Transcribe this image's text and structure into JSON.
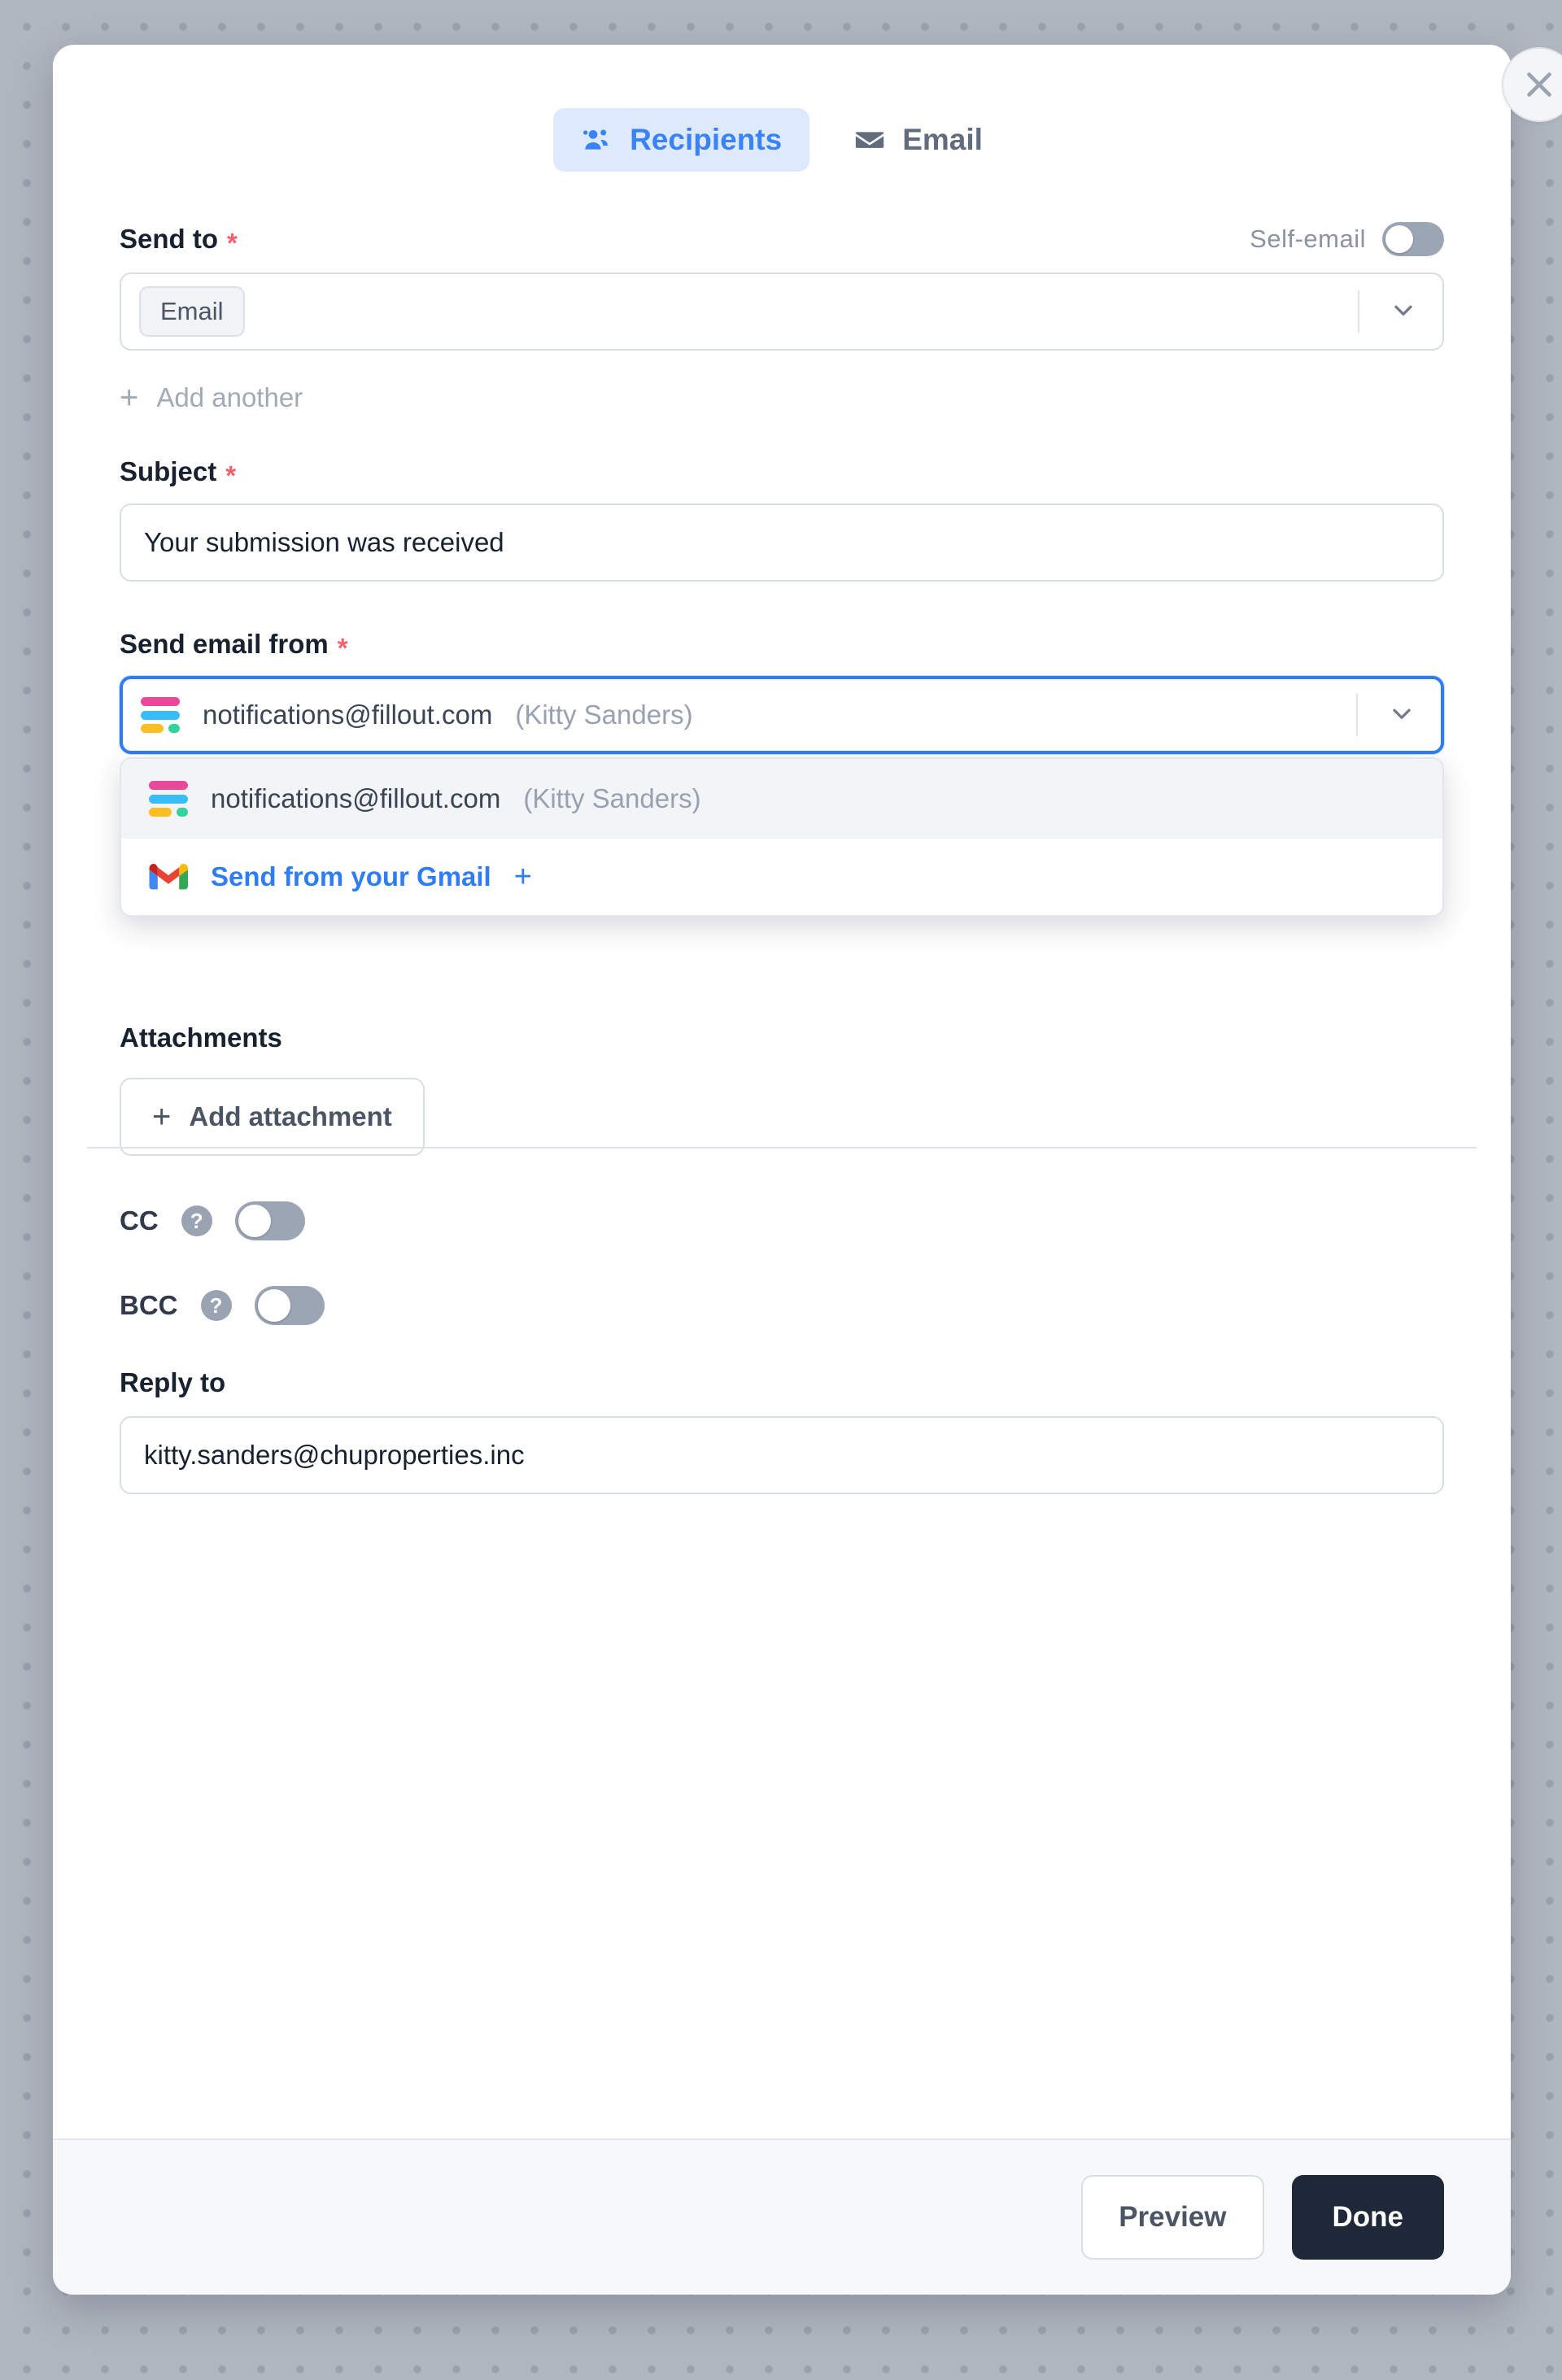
{
  "modal": {
    "close_label": "×"
  },
  "tabs": [
    {
      "label": "Recipients",
      "icon": "people-icon",
      "active": true
    },
    {
      "label": "Email",
      "icon": "envelope-icon",
      "active": false
    }
  ],
  "send_to": {
    "label": "Send to",
    "required_marker": "*",
    "self_email_label": "Self-email",
    "self_email_on": false,
    "chip_label": "Email",
    "add_another_label": "Add another",
    "add_another_plus": "+"
  },
  "subject": {
    "label": "Subject",
    "required_marker": "*",
    "value": "Your submission was received"
  },
  "send_email_from": {
    "label": "Send email from",
    "required_marker": "*",
    "selected_email": "notifications@fillout.com",
    "selected_name": "(Kitty Sanders)",
    "options": [
      {
        "icon": "fillout-logo-icon",
        "email": "notifications@fillout.com",
        "name": "(Kitty Sanders)",
        "highlighted": true
      },
      {
        "icon": "gmail-icon",
        "label": "Send from your Gmail",
        "plus": "+",
        "highlighted": false
      }
    ]
  },
  "attachments": {
    "label": "Attachments",
    "add_button_label": "Add attachment",
    "add_button_plus": "+"
  },
  "cc": {
    "label": "CC",
    "help_glyph": "?",
    "enabled": false
  },
  "bcc": {
    "label": "BCC",
    "help_glyph": "?",
    "enabled": false
  },
  "reply_to": {
    "label": "Reply to",
    "value": "kitty.sanders@chuproperties.inc"
  },
  "footer": {
    "preview_label": "Preview",
    "done_label": "Done"
  },
  "colors": {
    "accent_blue": "#2f7df6",
    "tab_active_bg": "#ddeafd",
    "required_red": "#f4606c",
    "primary_button_bg": "#1f2839",
    "fillout_pink": "#ec4899",
    "fillout_blue": "#38bdf8",
    "fillout_orange": "#fbbf24",
    "fillout_green": "#34d399"
  }
}
